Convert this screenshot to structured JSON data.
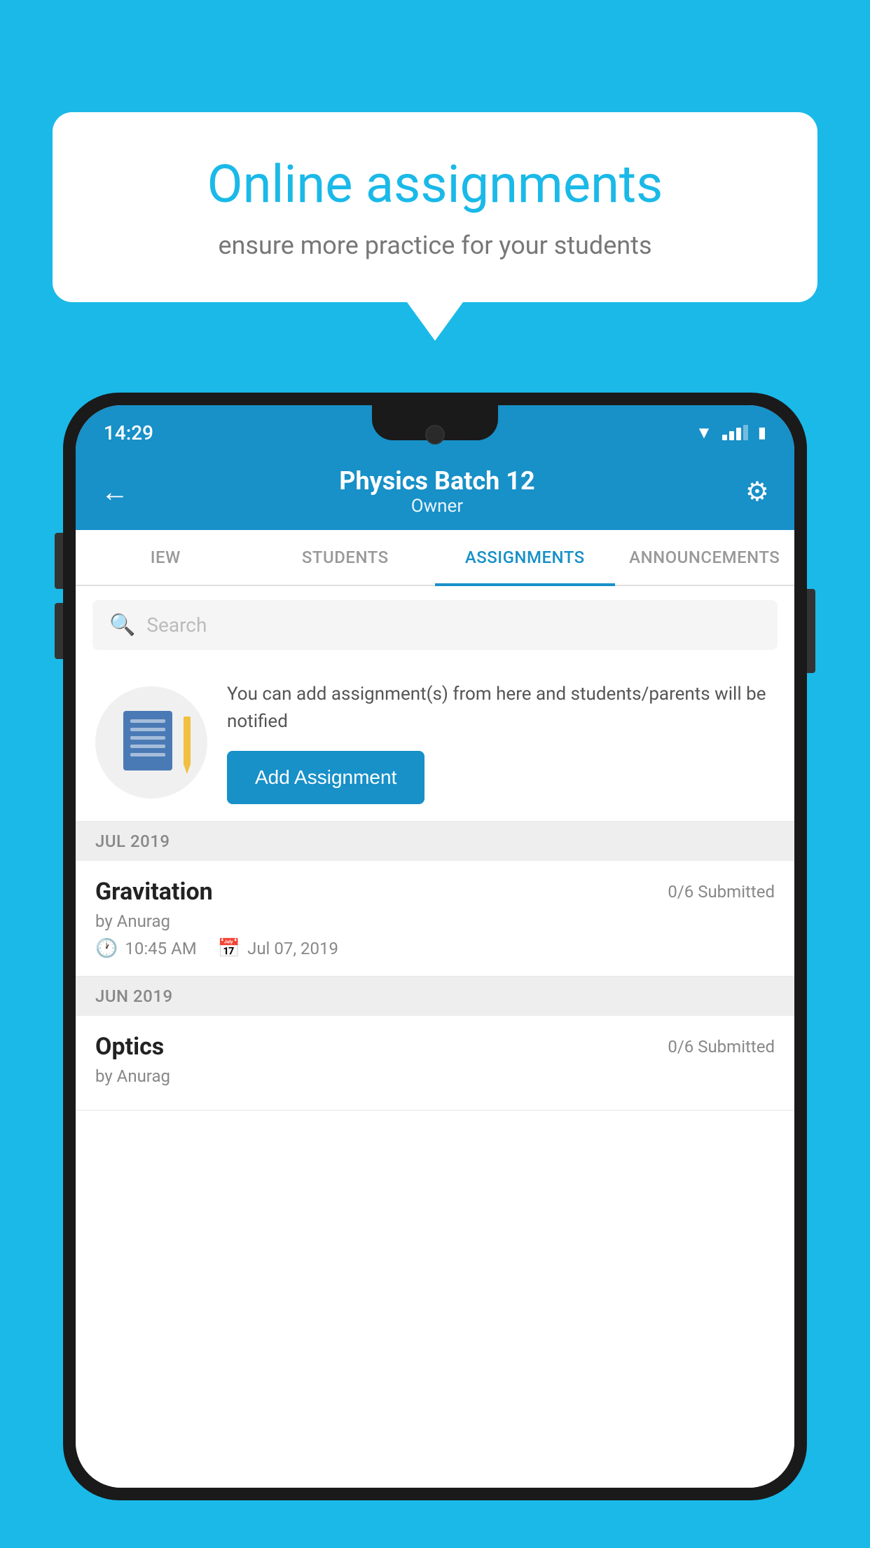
{
  "background_color": "#1ab9e8",
  "speech_bubble": {
    "title": "Online assignments",
    "subtitle": "ensure more practice for your students"
  },
  "phone": {
    "status_bar": {
      "time": "14:29",
      "icons": [
        "wifi",
        "signal",
        "battery"
      ]
    },
    "header": {
      "title": "Physics Batch 12",
      "subtitle": "Owner",
      "back_label": "←",
      "settings_label": "⚙"
    },
    "tabs": [
      {
        "label": "IEW",
        "active": false
      },
      {
        "label": "STUDENTS",
        "active": false
      },
      {
        "label": "ASSIGNMENTS",
        "active": true
      },
      {
        "label": "ANNOUNCEMENTS",
        "active": false
      }
    ],
    "search": {
      "placeholder": "Search"
    },
    "promo": {
      "text": "You can add assignment(s) from here and students/parents will be notified",
      "button_label": "Add Assignment"
    },
    "sections": [
      {
        "month": "JUL 2019",
        "assignments": [
          {
            "title": "Gravitation",
            "submitted": "0/6 Submitted",
            "author": "by Anurag",
            "time": "10:45 AM",
            "date": "Jul 07, 2019"
          }
        ]
      },
      {
        "month": "JUN 2019",
        "assignments": [
          {
            "title": "Optics",
            "submitted": "0/6 Submitted",
            "author": "by Anurag",
            "time": "",
            "date": ""
          }
        ]
      }
    ]
  }
}
